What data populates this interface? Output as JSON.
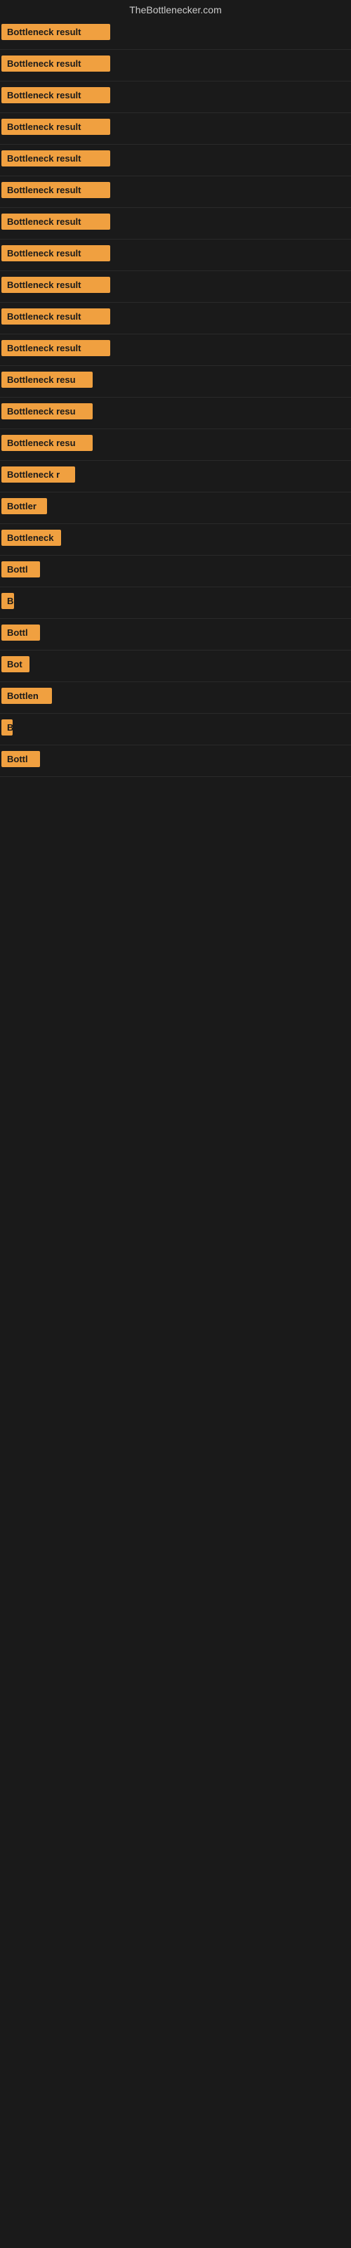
{
  "site": {
    "title": "TheBottlenecker.com"
  },
  "rows": [
    {
      "id": 1,
      "label": "Bottleneck result",
      "width": 155
    },
    {
      "id": 2,
      "label": "Bottleneck result",
      "width": 155
    },
    {
      "id": 3,
      "label": "Bottleneck result",
      "width": 155
    },
    {
      "id": 4,
      "label": "Bottleneck result",
      "width": 155
    },
    {
      "id": 5,
      "label": "Bottleneck result",
      "width": 155
    },
    {
      "id": 6,
      "label": "Bottleneck result",
      "width": 155
    },
    {
      "id": 7,
      "label": "Bottleneck result",
      "width": 155
    },
    {
      "id": 8,
      "label": "Bottleneck result",
      "width": 155
    },
    {
      "id": 9,
      "label": "Bottleneck result",
      "width": 155
    },
    {
      "id": 10,
      "label": "Bottleneck result",
      "width": 155
    },
    {
      "id": 11,
      "label": "Bottleneck result",
      "width": 155
    },
    {
      "id": 12,
      "label": "Bottleneck resu",
      "width": 130
    },
    {
      "id": 13,
      "label": "Bottleneck resu",
      "width": 130
    },
    {
      "id": 14,
      "label": "Bottleneck resu",
      "width": 130
    },
    {
      "id": 15,
      "label": "Bottleneck r",
      "width": 105
    },
    {
      "id": 16,
      "label": "Bottler",
      "width": 65
    },
    {
      "id": 17,
      "label": "Bottleneck",
      "width": 85
    },
    {
      "id": 18,
      "label": "Bottl",
      "width": 55
    },
    {
      "id": 19,
      "label": "B",
      "width": 18
    },
    {
      "id": 20,
      "label": "Bottl",
      "width": 55
    },
    {
      "id": 21,
      "label": "Bot",
      "width": 40
    },
    {
      "id": 22,
      "label": "Bottlen",
      "width": 72
    },
    {
      "id": 23,
      "label": "B",
      "width": 14
    },
    {
      "id": 24,
      "label": "Bottl",
      "width": 55
    }
  ]
}
